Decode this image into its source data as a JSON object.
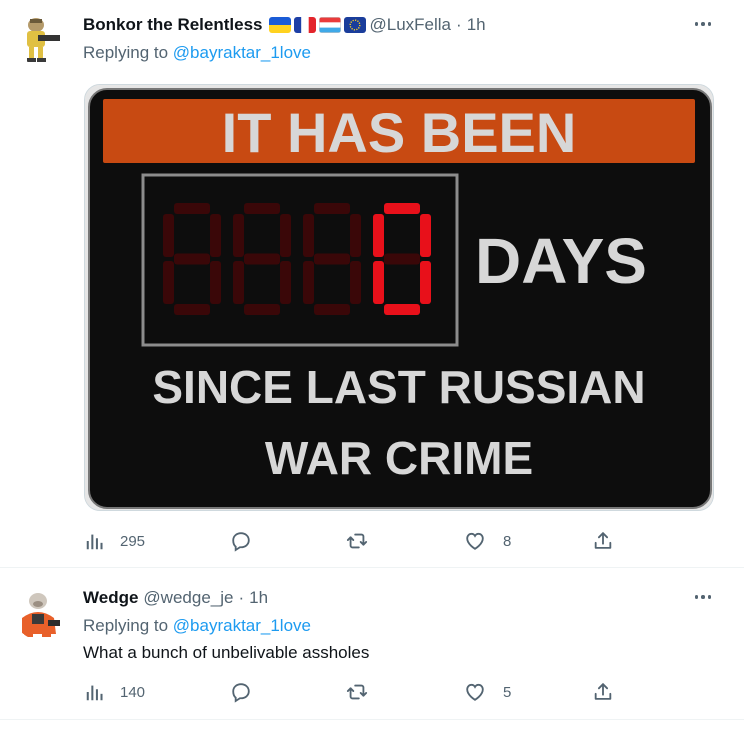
{
  "tweets": [
    {
      "author_name": "Bonkor the Relentless",
      "flags": [
        "ukraine-flag",
        "france-flag",
        "luxembourg-flag",
        "eu-flag"
      ],
      "handle": "@LuxFella",
      "separator": "·",
      "time": "1h",
      "replying_prefix": "Replying to ",
      "replying_to": "@bayraktar_1love",
      "media": {
        "header_text": "IT HAS BEEN",
        "digits": [
          "8",
          "8",
          "8",
          "0"
        ],
        "days_text": "DAYS",
        "line1": "SINCE LAST RUSSIAN",
        "line2": "WAR CRIME",
        "colors": {
          "banner": "#c84a12",
          "board": "#0d0d0d",
          "led_on": "#e8101a",
          "led_off": "#3a0708",
          "text": "#d7d7d7"
        }
      },
      "views": "295",
      "replies": "",
      "retweets": "",
      "likes": "8"
    },
    {
      "author_name": "Wedge",
      "handle": "@wedge_je",
      "separator": "·",
      "time": "1h",
      "replying_prefix": "Replying to ",
      "replying_to": "@bayraktar_1love",
      "text": "What a bunch of unbelivable assholes",
      "views": "140",
      "replies": "",
      "retweets": "",
      "likes": "5"
    }
  ],
  "colors": {
    "link": "#1d9bf0",
    "secondary": "#536471",
    "primary": "#0f1419",
    "divider": "#eff3f4"
  }
}
